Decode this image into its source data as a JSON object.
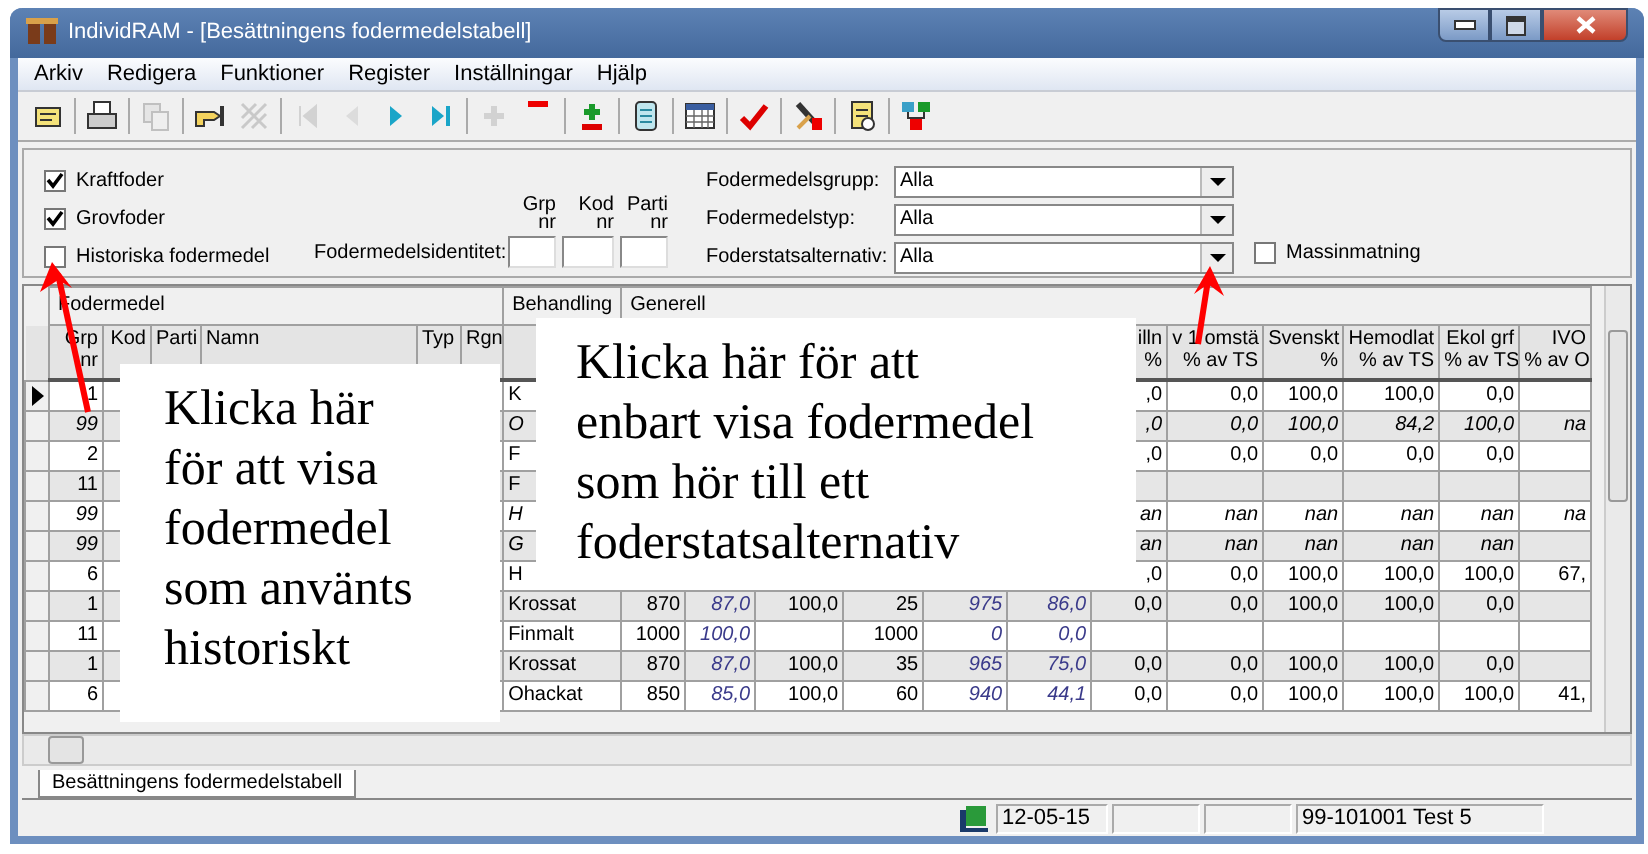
{
  "window": {
    "title": "IndividRAM - [Besättningens fodermedelstabell]"
  },
  "menu": [
    "Arkiv",
    "Redigera",
    "Funktioner",
    "Register",
    "Inställningar",
    "Hjälp"
  ],
  "toolbar": [
    {
      "kind": "card",
      "disabled": false
    },
    {
      "kind": "separator"
    },
    {
      "kind": "print",
      "disabled": false
    },
    {
      "kind": "separator"
    },
    {
      "kind": "copy",
      "disabled": true
    },
    {
      "kind": "separator"
    },
    {
      "kind": "pointer",
      "disabled": false
    },
    {
      "kind": "pattern",
      "disabled": true
    },
    {
      "kind": "separator"
    },
    {
      "kind": "first",
      "disabled": true
    },
    {
      "kind": "prev",
      "disabled": true
    },
    {
      "kind": "next",
      "disabled": false
    },
    {
      "kind": "last",
      "disabled": false
    },
    {
      "kind": "separator"
    },
    {
      "kind": "plus",
      "disabled": true
    },
    {
      "kind": "minus",
      "disabled": false
    },
    {
      "kind": "separator"
    },
    {
      "kind": "import",
      "disabled": false
    },
    {
      "kind": "separator"
    },
    {
      "kind": "notebook",
      "disabled": false
    },
    {
      "kind": "separator"
    },
    {
      "kind": "calendar",
      "disabled": false
    },
    {
      "kind": "separator"
    },
    {
      "kind": "check",
      "disabled": false
    },
    {
      "kind": "separator"
    },
    {
      "kind": "tools",
      "disabled": false
    },
    {
      "kind": "separator"
    },
    {
      "kind": "report",
      "disabled": false
    },
    {
      "kind": "separator"
    },
    {
      "kind": "network",
      "disabled": false
    }
  ],
  "filters": {
    "checkboxes": [
      {
        "label": "Kraftfoder",
        "checked": true
      },
      {
        "label": "Grovfoder",
        "checked": true
      },
      {
        "label": "Historiska fodermedel",
        "checked": false
      }
    ],
    "identity": {
      "label": "Fodermedelsidentitet:",
      "fields": [
        "Grp\nnr",
        "Kod\nnr",
        "Parti\nnr"
      ]
    },
    "dropdowns": [
      {
        "label": "Fodermedelsgrupp:",
        "value": "Alla"
      },
      {
        "label": "Fodermedelstyp:",
        "value": "Alla"
      },
      {
        "label": "Foderstatsalternativ:",
        "value": "Alla"
      }
    ],
    "mass_entry": {
      "label": "Massinmatning",
      "checked": false
    }
  },
  "table": {
    "group_headers": [
      {
        "label": "Fodermedel"
      },
      {
        "label": "Behandling"
      },
      {
        "label": "Generell"
      }
    ],
    "columns": [
      {
        "label": "Grp\nnr",
        "kind": "number"
      },
      {
        "label": "Kod",
        "kind": "number"
      },
      {
        "label": "Parti",
        "kind": "number"
      },
      {
        "label": "Namn",
        "kind": "text"
      },
      {
        "label": "Typ",
        "kind": "text"
      },
      {
        "label": "Rgn",
        "kind": "text"
      },
      {
        "kind": "text"
      },
      {
        "kind": "number"
      },
      {
        "kind": "computed"
      },
      {
        "kind": "number"
      },
      {
        "kind": "number"
      },
      {
        "kind": "computed"
      },
      {
        "kind": "computed"
      },
      {
        "label": "illn\n%",
        "kind": "number"
      },
      {
        "label": "v 1 omstä\n% av TS",
        "kind": "number"
      },
      {
        "label": "Svenskt\n%",
        "kind": "number"
      },
      {
        "label": "Hemodlat\n% av TS",
        "kind": "number"
      },
      {
        "label": "Ekol grf\n% av TS",
        "kind": "number"
      },
      {
        "label": "IVO\n% av O",
        "kind": "number"
      }
    ],
    "rows": [
      {
        "selected": true,
        "italic": false,
        "cells": [
          "1",
          "",
          "",
          "",
          "",
          "",
          "K",
          "",
          "",
          "",
          "",
          "",
          "",
          ",0",
          "0,0",
          "100,0",
          "100,0",
          "0,0",
          ""
        ]
      },
      {
        "selected": false,
        "italic": true,
        "cells": [
          "99",
          "",
          "",
          "",
          "",
          "",
          "O",
          "",
          "",
          "",
          "",
          "",
          "",
          ",0",
          "0,0",
          "100,0",
          "84,2",
          "100,0",
          "na"
        ]
      },
      {
        "selected": false,
        "italic": false,
        "cells": [
          "2",
          "",
          "",
          "",
          "",
          "",
          "F",
          "",
          "",
          "",
          "",
          "",
          "",
          ",0",
          "0,0",
          "0,0",
          "0,0",
          "0,0",
          ""
        ]
      },
      {
        "selected": false,
        "italic": false,
        "cells": [
          "11",
          "",
          "",
          "",
          "",
          "",
          "F",
          "",
          "",
          "",
          "",
          "",
          "",
          "",
          "",
          "",
          "",
          "",
          ""
        ]
      },
      {
        "selected": false,
        "italic": true,
        "cells": [
          "99",
          "",
          "",
          "",
          "",
          "",
          "H",
          "",
          "",
          "",
          "",
          "",
          "",
          "an",
          "nan",
          "nan",
          "nan",
          "nan",
          "na"
        ]
      },
      {
        "selected": false,
        "italic": true,
        "cells": [
          "99",
          "",
          "",
          "",
          "",
          "",
          "G",
          "",
          "",
          "",
          "",
          "",
          "",
          "an",
          "nan",
          "nan",
          "nan",
          "nan",
          ""
        ]
      },
      {
        "selected": false,
        "italic": false,
        "cells": [
          "6",
          "",
          "",
          "",
          "",
          "",
          "H",
          "",
          "",
          "",
          "",
          "",
          "",
          ",0",
          "0,0",
          "100,0",
          "100,0",
          "100,0",
          "67,"
        ]
      },
      {
        "selected": false,
        "italic": false,
        "cells": [
          "1",
          "",
          "",
          "",
          "",
          "",
          "Krossat",
          "870",
          "87,0",
          "100,0",
          "25",
          "975",
          "86,0",
          "0,0",
          "0,0",
          "100,0",
          "100,0",
          "0,0",
          ""
        ]
      },
      {
        "selected": false,
        "italic": false,
        "cells": [
          "11",
          "",
          "",
          "",
          "",
          "",
          "Finmalt",
          "1000",
          "100,0",
          "",
          "1000",
          "0",
          "0,0",
          "",
          "",
          "",
          "",
          "",
          ""
        ]
      },
      {
        "selected": false,
        "italic": false,
        "cells": [
          "1",
          "",
          "",
          "",
          "",
          "",
          "Krossat",
          "870",
          "87,0",
          "100,0",
          "35",
          "965",
          "75,0",
          "0,0",
          "0,0",
          "100,0",
          "100,0",
          "0,0",
          ""
        ]
      },
      {
        "selected": false,
        "italic": false,
        "cells": [
          "6",
          "",
          "",
          "",
          "",
          "",
          "Ohackat",
          "850",
          "85,0",
          "100,0",
          "60",
          "940",
          "44,1",
          "0,0",
          "0,0",
          "100,0",
          "100,0",
          "100,0",
          "41,"
        ]
      }
    ]
  },
  "tabs": [
    {
      "label": "Besättningens fodermedelstabell",
      "selected": true
    }
  ],
  "status_bar": {
    "date": "12-05-15",
    "user": "99-101001 Test 5"
  },
  "annotations": [
    {
      "text": "Klicka här\nför att visa\nfodermedel\nsom använts\nhistoriskt"
    },
    {
      "text": "Klicka här för att\nenbart visa fodermedel\nsom hör till ett\nfoderstatsalternativ"
    }
  ]
}
